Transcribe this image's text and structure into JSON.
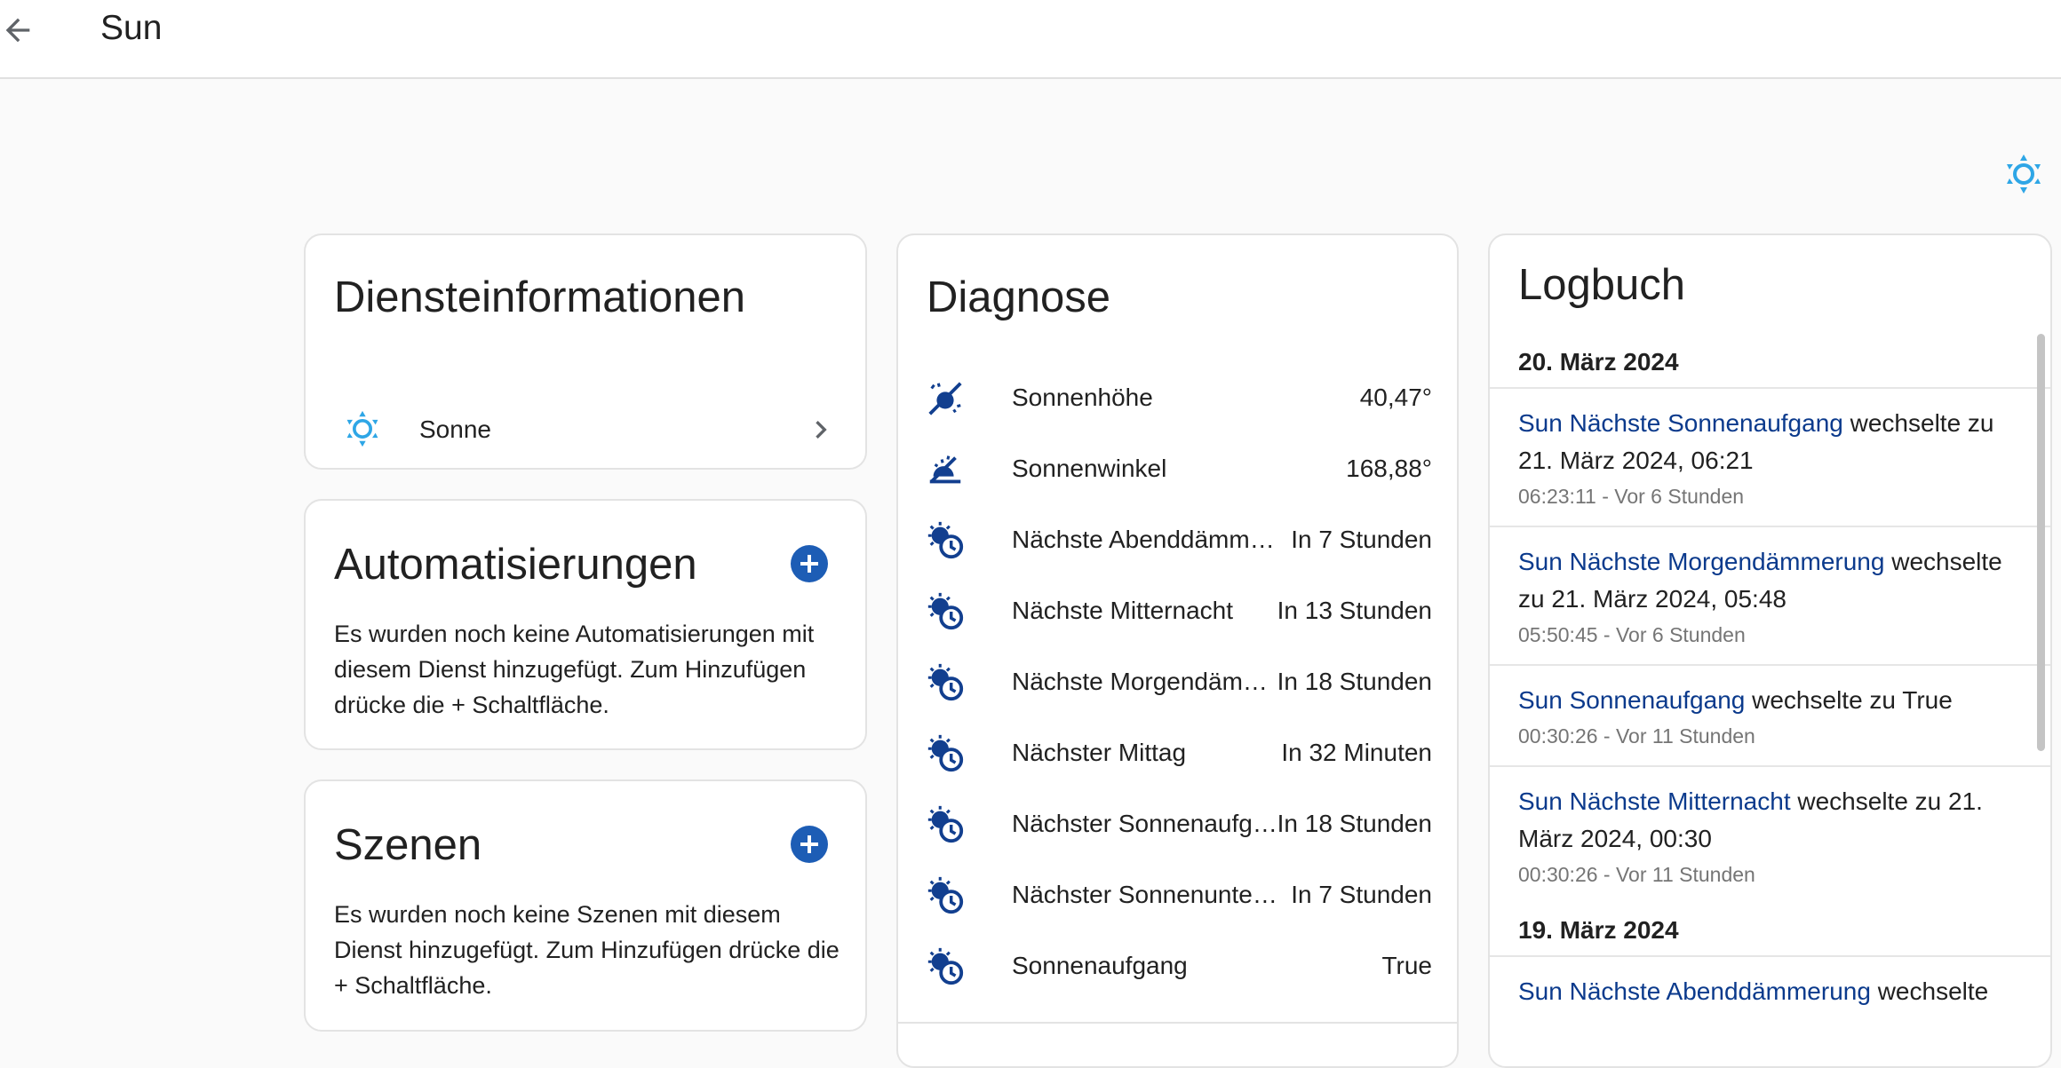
{
  "header": {
    "title": "Sun"
  },
  "info_card": {
    "title": "Diensteinformationen",
    "item_label": "Sonne"
  },
  "automations_card": {
    "title": "Automatisierungen",
    "text": "Es wurden noch keine Automatisierungen mit diesem Dienst hinzugefügt. Zum Hinzufügen drücke die + Schaltfläche."
  },
  "scenes_card": {
    "title": "Szenen",
    "text": "Es wurden noch keine Szenen mit diesem Dienst hinzugefügt. Zum Hinzufügen drücke die + Schaltfläche."
  },
  "diagnose_card": {
    "title": "Diagnose",
    "rows": [
      {
        "icon": "sun-angle-icon",
        "label": "Sonnenhöhe",
        "value": "40,47°"
      },
      {
        "icon": "sun-azimuth-icon",
        "label": "Sonnenwinkel",
        "value": "168,88°"
      },
      {
        "icon": "sun-clock-icon",
        "label": "Nächste Abenddämmerung",
        "value": "In 7 Stunden"
      },
      {
        "icon": "sun-clock-icon",
        "label": "Nächste Mitternacht",
        "value": "In 13 Stunden"
      },
      {
        "icon": "sun-clock-icon",
        "label": "Nächste Morgendämmerung",
        "value": "In 18 Stunden"
      },
      {
        "icon": "sun-clock-icon",
        "label": "Nächster Mittag",
        "value": "In 32 Minuten"
      },
      {
        "icon": "sun-clock-icon",
        "label": "Nächster Sonnenaufgang",
        "value": "In 18 Stunden"
      },
      {
        "icon": "sun-clock-icon",
        "label": "Nächster Sonnenuntergang",
        "value": "In 7 Stunden"
      },
      {
        "icon": "sun-clock-icon",
        "label": "Sonnenaufgang",
        "value": "True"
      }
    ]
  },
  "logbook_card": {
    "title": "Logbuch",
    "date_1": "20. März 2024",
    "entries": [
      {
        "entity": "Sun Nächste Sonnenaufgang",
        "text": "wechselte zu 21. März 2024, 06:21",
        "time": "06:23:11 - Vor 6 Stunden"
      },
      {
        "entity": "Sun Nächste Morgendämmerung",
        "text": "wechselte zu 21. März 2024, 05:48",
        "time": "05:50:45 - Vor 6 Stunden"
      },
      {
        "entity": "Sun Sonnenaufgang",
        "text": "wechselte zu True",
        "time": "00:30:26 - Vor 11 Stunden"
      },
      {
        "entity": "Sun Nächste Mitternacht",
        "text": "wechselte zu 21. März 2024, 00:30",
        "time": "00:30:26 - Vor 11 Stunden"
      }
    ],
    "date_2": "19. März 2024",
    "next_entry": {
      "entity": "Sun Nächste Abenddämmerung",
      "text": "wechselte"
    }
  },
  "colors": {
    "accent": "#1d5db5",
    "sun_icon": "#2ea6e6",
    "link": "#0b3a8c",
    "diag_icon": "#123f8f"
  }
}
